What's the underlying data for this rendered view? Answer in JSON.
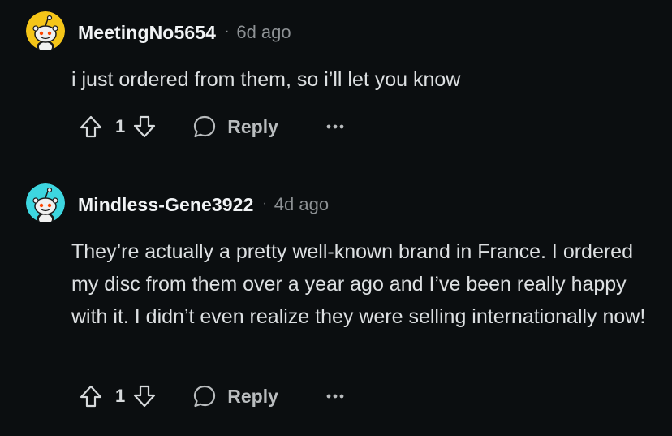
{
  "comments": [
    {
      "username": "MeetingNo5654",
      "separator": "·",
      "time": "6d ago",
      "body": "i just ordered from them, so i’ll let you know",
      "votes": "1",
      "reply_label": "Reply",
      "avatar_color": "#f5c518"
    },
    {
      "username": "Mindless-Gene3922",
      "separator": "·",
      "time": "4d ago",
      "body": "They’re actually a pretty well-known brand in France. I ordered my disc from them over a year ago and I’ve been really happy with it. I didn’t even realize they were selling internationally now!",
      "votes": "1",
      "reply_label": "Reply",
      "avatar_color": "#3dd6e0"
    }
  ],
  "icons": {
    "upvote": "upvote-arrow-icon",
    "downvote": "downvote-arrow-icon",
    "reply": "speech-bubble-icon",
    "more": "more-dots-icon"
  }
}
